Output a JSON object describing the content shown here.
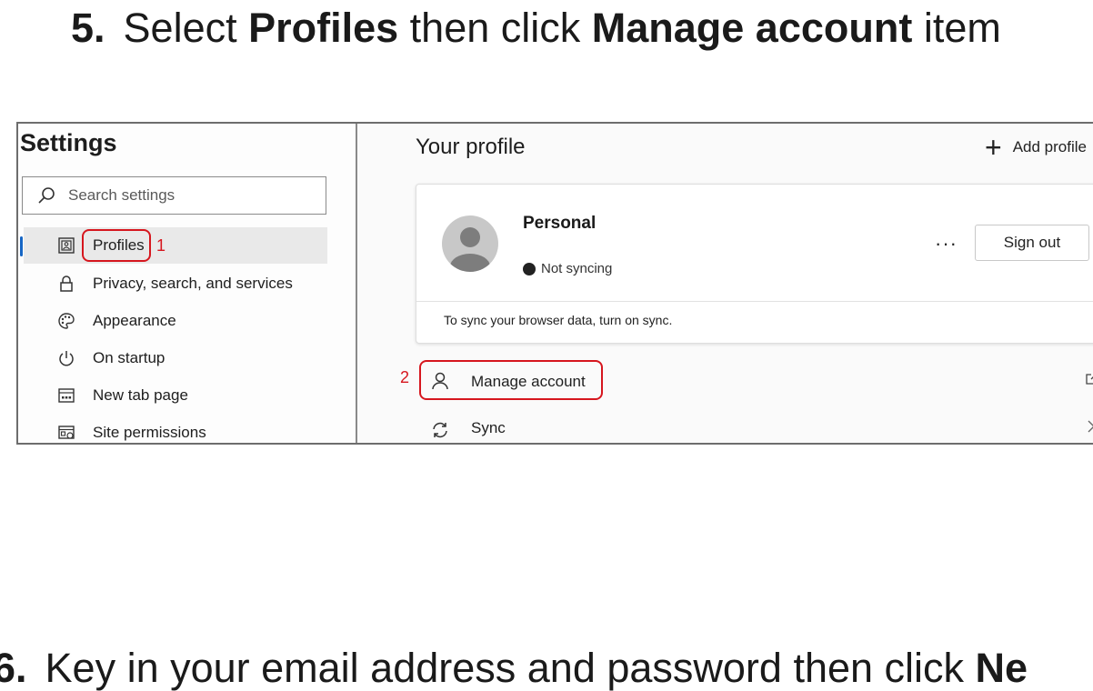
{
  "step5": {
    "num": "5.",
    "prefix": "Select ",
    "bold1": "Profiles",
    "mid": " then click ",
    "bold2": "Manage account",
    "suffix": " item"
  },
  "step6": {
    "num": "6.",
    "prefix": "Key in your email address and password then click ",
    "bold": "Ne"
  },
  "sidebar": {
    "title": "Settings",
    "search_placeholder": "Search settings",
    "items": [
      {
        "label": "Profiles",
        "icon": "profile-card-icon",
        "active": true
      },
      {
        "label": "Privacy, search, and services",
        "icon": "lock-icon"
      },
      {
        "label": "Appearance",
        "icon": "palette-icon"
      },
      {
        "label": "On startup",
        "icon": "power-icon"
      },
      {
        "label": "New tab page",
        "icon": "new-tab-icon"
      },
      {
        "label": "Site permissions",
        "icon": "site-permissions-icon"
      }
    ],
    "accent": "#1666c5"
  },
  "main": {
    "heading": "Your profile",
    "add_profile": "Add profile",
    "card": {
      "name": "Personal",
      "status": "Not syncing",
      "more": "···",
      "sign_out": "Sign out",
      "hint": "To sync your browser data, turn on sync."
    },
    "rows": [
      {
        "label": "Manage account",
        "icon": "person-icon",
        "trailing": "external-link-icon"
      },
      {
        "label": "Sync",
        "icon": "sync-icon",
        "trailing": "chevron-right-icon"
      }
    ]
  },
  "annotations": {
    "profiles": "1",
    "manage": "2",
    "color": "#d6161e"
  }
}
